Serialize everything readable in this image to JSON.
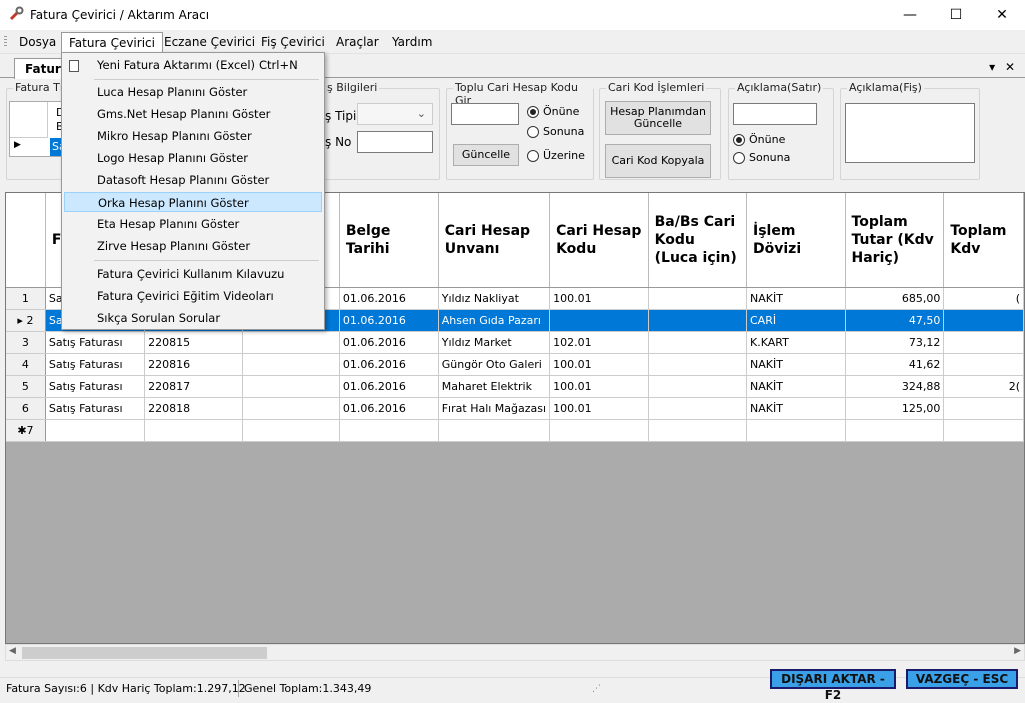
{
  "window": {
    "title": "Fatura Çevirici / Aktarım Aracı",
    "minimize": "—",
    "maximize": "☐",
    "close": "✕"
  },
  "menu": {
    "items": [
      "Dosya",
      "Fatura Çevirici",
      "Eczane Çevirici",
      "Fiş Çevirici",
      "Araçlar",
      "Yardım"
    ]
  },
  "tab": {
    "label": "Fatura",
    "dropdown": "▾",
    "close": "✕"
  },
  "dropdown": {
    "items": [
      {
        "label": "Yeni Fatura Aktarımı (Excel)",
        "shortcut": "Ctrl+N"
      },
      {
        "label": "Luca Hesap Planını Göster"
      },
      {
        "label": "Gms.Net Hesap Planını Göster"
      },
      {
        "label": "Mikro Hesap Planını Göster"
      },
      {
        "label": "Logo Hesap Planını Göster"
      },
      {
        "label": "Datasoft Hesap Planını Göster"
      },
      {
        "label": "Orka Hesap Planını Göster"
      },
      {
        "label": "Eta Hesap Planını Göster"
      },
      {
        "label": "Zirve Hesap Planını Göster"
      },
      {
        "label": "Fatura Çevirici Kullanım Kılavuzu"
      },
      {
        "label": "Fatura Çevirici Eğitim Videoları"
      },
      {
        "label": "Sıkça Sorulan Sorular"
      }
    ]
  },
  "panels": {
    "fatura_tipi": {
      "label": "Fatura Tı",
      "cell1": "D",
      "cell2": "B",
      "sel_cell": "Sa"
    },
    "fis_bilgileri": {
      "label": "ş Bilgileri",
      "tip_label": "ş Tipi",
      "no_label": "ş No"
    },
    "toplu": {
      "label": "Toplu Cari Hesap Kodu Gir",
      "onune": "Önüne",
      "sonuna": "Sonuna",
      "uzerine": "Üzerine",
      "guncelle": "Güncelle"
    },
    "cari": {
      "label": "Cari Kod İşlemleri",
      "btn1": "Hesap Planımdan Güncelle",
      "btn2": "Cari Kod Kopyala"
    },
    "aciklama_satir": {
      "label": "Açıklama(Satır)",
      "onune": "Önüne",
      "sonuna": "Sonuna"
    },
    "aciklama_fis": {
      "label": "Açıklama(Fiş)"
    }
  },
  "grid": {
    "columns": [
      "F T",
      "",
      "",
      "Belge Tarihi",
      "Cari Hesap Unvanı",
      "Cari Hesap Kodu",
      "Ba/Bs Cari Kodu (Luca için)",
      "İşlem Dövizi",
      "Toplam Tutar (Kdv Hariç)",
      "Toplam Kdv"
    ],
    "rows": [
      {
        "n": "1",
        "tip": "Sa",
        "no": "",
        "x": "",
        "tarih": "01.06.2016",
        "unvan": "Yıldız Nakliyat",
        "kod": "100.01",
        "babs": "",
        "doviz": "NAKİT",
        "tutar": "685,00",
        "kdv": "("
      },
      {
        "n": "2",
        "tip": "Sa",
        "no": "",
        "x": "",
        "tarih": "01.06.2016",
        "unvan": "Ahsen Gıda Pazarı",
        "kod": "",
        "babs": "",
        "doviz": "CARİ",
        "tutar": "47,50",
        "kdv": ""
      },
      {
        "n": "3",
        "tip": "Satış Faturası",
        "no": "220815",
        "x": "",
        "tarih": "01.06.2016",
        "unvan": "Yıldız Market",
        "kod": "102.01",
        "babs": "",
        "doviz": "K.KART",
        "tutar": "73,12",
        "kdv": ""
      },
      {
        "n": "4",
        "tip": "Satış Faturası",
        "no": "220816",
        "x": "",
        "tarih": "01.06.2016",
        "unvan": "Güngör Oto Galeri",
        "kod": "100.01",
        "babs": "",
        "doviz": "NAKİT",
        "tutar": "41,62",
        "kdv": ""
      },
      {
        "n": "5",
        "tip": "Satış Faturası",
        "no": "220817",
        "x": "",
        "tarih": "01.06.2016",
        "unvan": "Maharet Elektrik",
        "kod": "100.01",
        "babs": "",
        "doviz": "NAKİT",
        "tutar": "324,88",
        "kdv": "2("
      },
      {
        "n": "6",
        "tip": "Satış Faturası",
        "no": "220818",
        "x": "",
        "tarih": "01.06.2016",
        "unvan": "Fırat Halı Mağazası",
        "kod": "100.01",
        "babs": "",
        "doviz": "NAKİT",
        "tutar": "125,00",
        "kdv": ""
      }
    ],
    "new_row": "✱7"
  },
  "status": {
    "left": "Fatura Sayısı:6 | Kdv Hariç Toplam:1.297,12",
    "mid": "Genel Toplam:1.343,49",
    "export": "DIŞARI AKTAR - F2",
    "cancel": "VAZGEÇ - ESC"
  }
}
